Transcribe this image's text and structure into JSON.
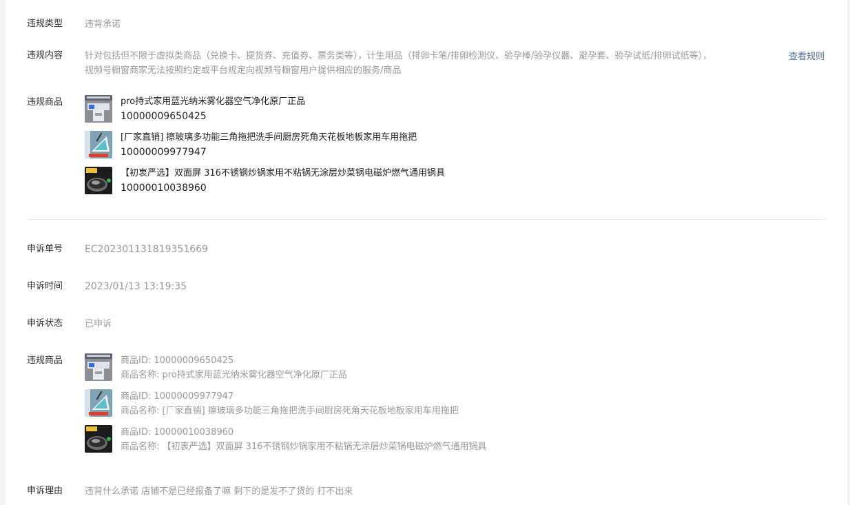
{
  "violation": {
    "type_label": "违规类型",
    "type_value": "违背承诺",
    "content_label": "违规内容",
    "content_line1": "针对包括但不限于虚拟类商品（兑换卡、提货券、充值券、票务类等），计生用品（排卵卡笔/排卵检测仪、验孕棒/验孕仪器、避孕套、验孕试纸/排卵试纸等），",
    "content_line2": "视频号橱窗商家无法按照约定或平台规定向视频号橱窗用户提供相应的服务/商品",
    "view_rules_link": "查看规则",
    "products_label": "违规商品",
    "products": [
      {
        "name": "pro持式家用蓝光纳米雾化器空气净化原厂正品",
        "id": "10000009650425",
        "thumb_icon": "air-purifier-thumb"
      },
      {
        "name": "[厂家直销] 擦玻璃多功能三角拖把洗手间厨房死角天花板地板家用车用拖把",
        "id": "10000009977947",
        "thumb_icon": "triangle-mop-thumb"
      },
      {
        "name": "【初衷严选】双面屏 316不锈钢炒锅家用不粘锅无涂层炒菜锅电磁炉燃气通用锅具",
        "id": "10000010038960",
        "thumb_icon": "wok-thumb"
      }
    ]
  },
  "appeal": {
    "number_label": "申诉单号",
    "number_value": "EC202301131819351669",
    "time_label": "申诉时间",
    "time_value": "2023/01/13 13:19:35",
    "status_label": "申诉状态",
    "status_value": "已申诉",
    "products_label": "违规商品",
    "products": [
      {
        "id_line": "商品ID: 10000009650425",
        "name_line": "商品名称: pro持式家用蓝光纳米雾化器空气净化原厂正品",
        "thumb_icon": "air-purifier-thumb"
      },
      {
        "id_line": "商品ID: 10000009977947",
        "name_line": "商品名称: [厂家直销] 擦玻璃多功能三角拖把洗手间厨房死角天花板地板家用车用拖把",
        "thumb_icon": "triangle-mop-thumb"
      },
      {
        "id_line": "商品ID: 10000010038960",
        "name_line": "商品名称: 【初衷严选】双面屏 316不锈钢炒锅家用不粘锅无涂层炒菜锅电磁炉燃气通用锅具",
        "thumb_icon": "wok-thumb"
      }
    ],
    "reason_label": "申诉理由",
    "reason_value": "违背什么承诺 店铺不是已经报备了嘛 剩下的是发不了货的 打不出来"
  },
  "colors": {
    "link": "#576b95",
    "muted_text": "#999999",
    "primary_text": "#333333",
    "divider": "#ececec"
  }
}
